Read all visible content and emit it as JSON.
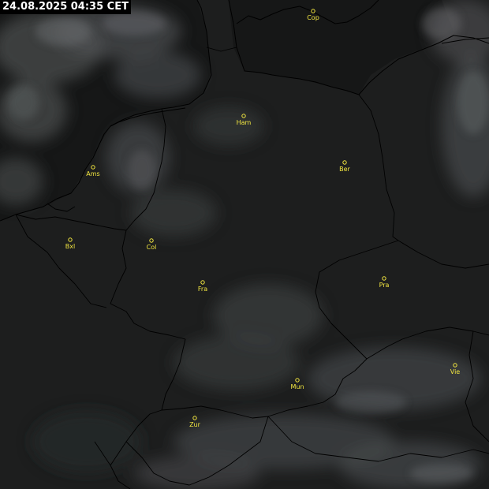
{
  "timestamp": "24.08.2025 04:35 CET",
  "colors": {
    "label": "#f2e640",
    "background": "#1b1c1c",
    "sea": "#161717",
    "cloud": "#4a4d4f",
    "border": "#000000"
  },
  "cities": [
    {
      "id": "cop",
      "label": "Cop"
    },
    {
      "id": "ham",
      "label": "Ham"
    },
    {
      "id": "ams",
      "label": "Ams"
    },
    {
      "id": "ber",
      "label": "Ber"
    },
    {
      "id": "bxl",
      "label": "Bxl"
    },
    {
      "id": "col",
      "label": "Col"
    },
    {
      "id": "fra",
      "label": "Fra"
    },
    {
      "id": "pra",
      "label": "Pra"
    },
    {
      "id": "mun",
      "label": "Mun"
    },
    {
      "id": "vie",
      "label": "Vie"
    },
    {
      "id": "zur",
      "label": "Zur"
    }
  ]
}
